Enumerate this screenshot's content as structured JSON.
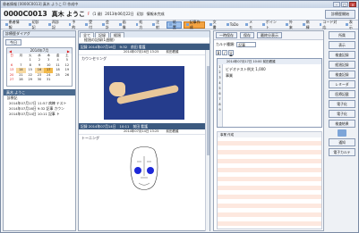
{
  "window": {
    "title": "患者情報 [0000C0013] 真木 ようこ F/ 作成中"
  },
  "patient": {
    "id": "0000C0013",
    "name": "真木 ようこ",
    "sex": "F",
    "age": "(1 歳)",
    "birthday": "2013年06月22日",
    "status": "初診",
    "extra": "情報未完成",
    "action": "診療歴開始"
  },
  "toolbar": [
    "患者情報",
    "初診記",
    "再診記",
    "予約",
    "受付",
    "会計",
    "画像",
    "処方",
    "注射",
    "処置",
    "記事作成",
    "文書",
    "ToDo",
    "メモ",
    "ポイント",
    "外来",
    "病棟",
    "コード対応",
    "表示"
  ],
  "left": {
    "header": "診療歴ダイアグ",
    "today_btn": "今日",
    "calendar": {
      "month": "2014年7月",
      "weekdays": [
        "日",
        "月",
        "火",
        "水",
        "木",
        "金",
        "土"
      ],
      "days": [
        "",
        "",
        "1",
        "2",
        "3",
        "4",
        "5",
        "6",
        "7",
        "8",
        "9",
        "10",
        "11",
        "12",
        "13",
        "14",
        "15",
        "16",
        "17",
        "18",
        "19",
        "20",
        "21",
        "22",
        "23",
        "24",
        "25",
        "26",
        "27",
        "28",
        "29",
        "30",
        "31",
        "",
        ""
      ]
    },
    "tree_header": "真木 ようこ",
    "tree": [
      "診療記",
      "2014年07月17日 11:57 病棟 テスト",
      "2014年07月16日 9:32 記事 カウン",
      "2014年07月14日 10:11 記事 ト"
    ]
  },
  "middle": {
    "tabs": [
      "全て",
      "記録",
      "経過"
    ],
    "filter": "経過の記録(1週間)",
    "entry1": {
      "date": "記録 2014年07月16日",
      "time": "9:32",
      "author": "前田 看護",
      "sub1": "2014年07月16日 13:25",
      "sub2": "前田看護",
      "title": "カウンセリング"
    },
    "entry2": {
      "date": "記録 2014年07月14日",
      "time": "10:11",
      "author": "前田 看護",
      "sub1": "2014年07月14日 13:25",
      "sub2": "前田看護",
      "title": "トーニング"
    }
  },
  "right": {
    "new_btn": "一時保存",
    "save_btn": "保存",
    "recent_btn": "最終分表示",
    "category_label": "カルテ種類:",
    "category": "記事",
    "editor_header": "2014年07月17日 10:00 前田看護",
    "editor_text": "ビデオテスト例文 1,000",
    "line_label": "事業",
    "lined_header": "事業 作成"
  },
  "side": [
    "所属",
    "表示",
    "検査記録",
    "経過記録",
    "検査記録",
    "レミーダ",
    "医療記載",
    "電子化",
    "電子化",
    "検査結果",
    "通知",
    "電子カルテ"
  ]
}
